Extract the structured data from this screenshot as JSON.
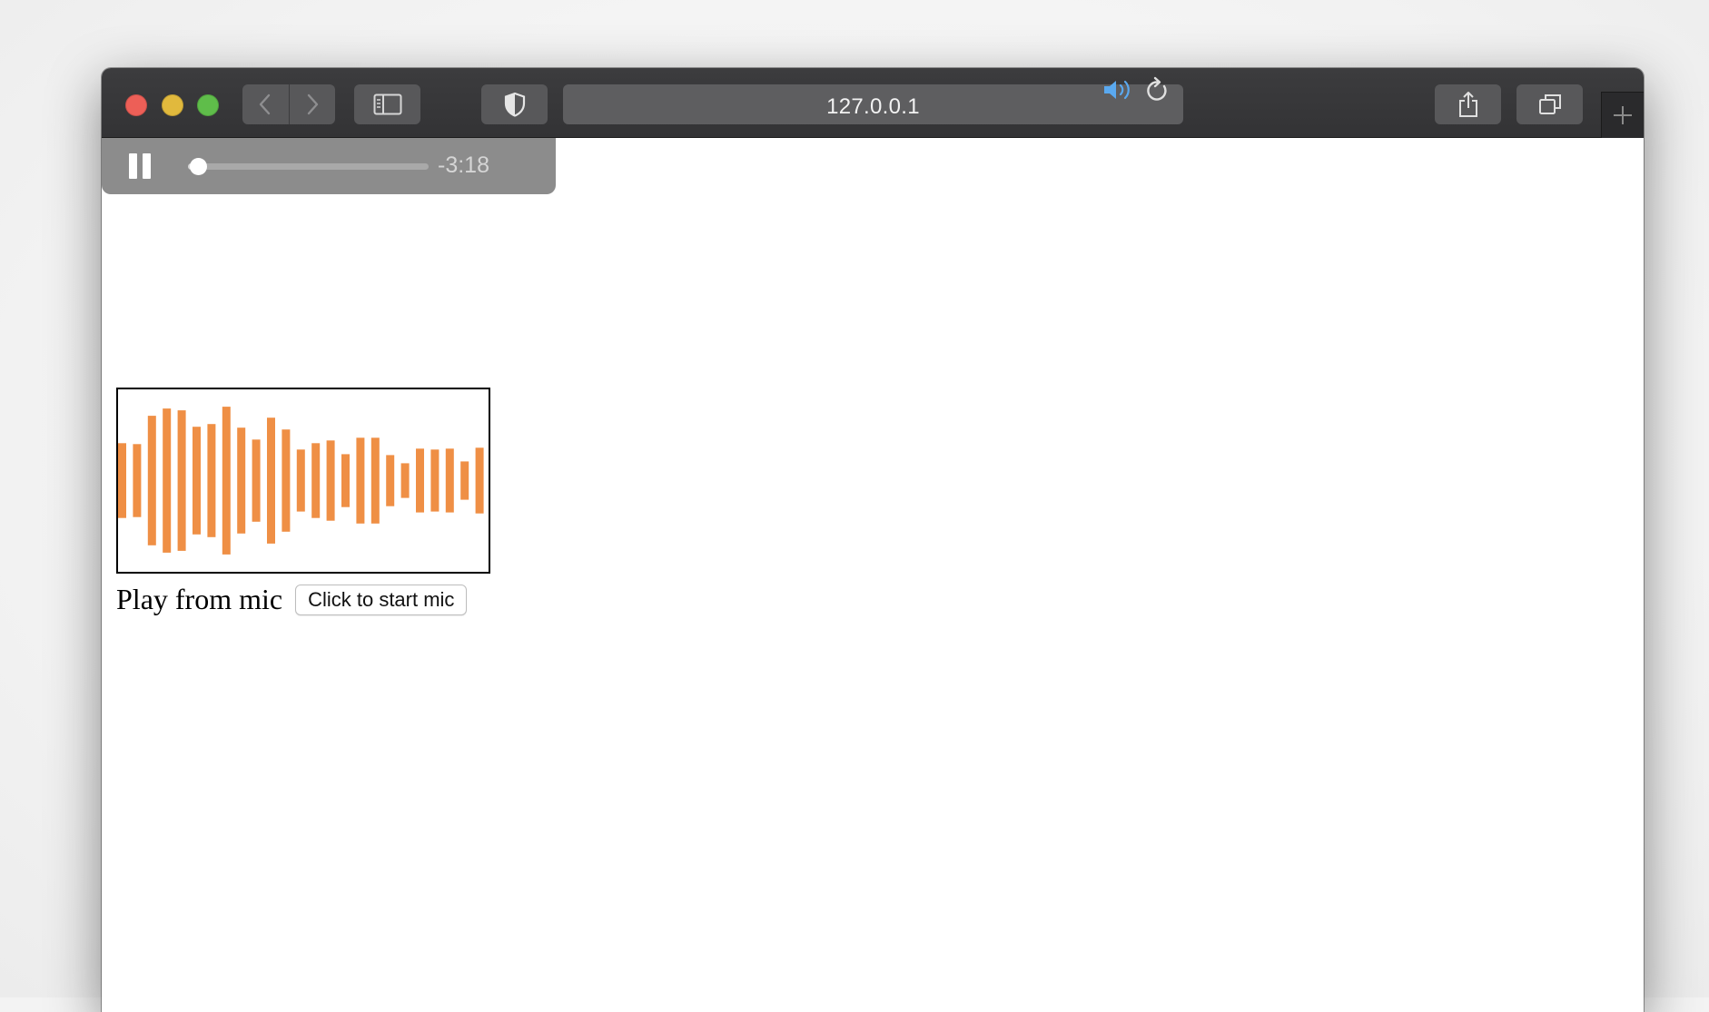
{
  "browser": {
    "address": "127.0.0.1",
    "icons": {
      "back": "chevron-left-icon",
      "forward": "chevron-right-icon",
      "sidebar": "sidebar-icon",
      "privacy": "shield-icon",
      "audio": "speaker-icon",
      "reload": "reload-icon",
      "share": "share-icon",
      "tabs": "tabs-icon",
      "new_tab": "plus-icon"
    }
  },
  "pip_player": {
    "time_remaining": "-3:18",
    "progress": 0.04,
    "state": "playing"
  },
  "visualizer": {
    "bar_color": "#ef8f45",
    "levels": [
      0.41,
      0.4,
      0.71,
      0.79,
      0.77,
      0.59,
      0.62,
      0.81,
      0.58,
      0.45,
      0.69,
      0.56,
      0.34,
      0.41,
      0.44,
      0.29,
      0.47,
      0.47,
      0.28,
      0.19,
      0.35,
      0.34,
      0.35,
      0.21,
      0.36
    ]
  },
  "mic": {
    "label": "Play from mic",
    "button_label": "Click to start mic"
  }
}
